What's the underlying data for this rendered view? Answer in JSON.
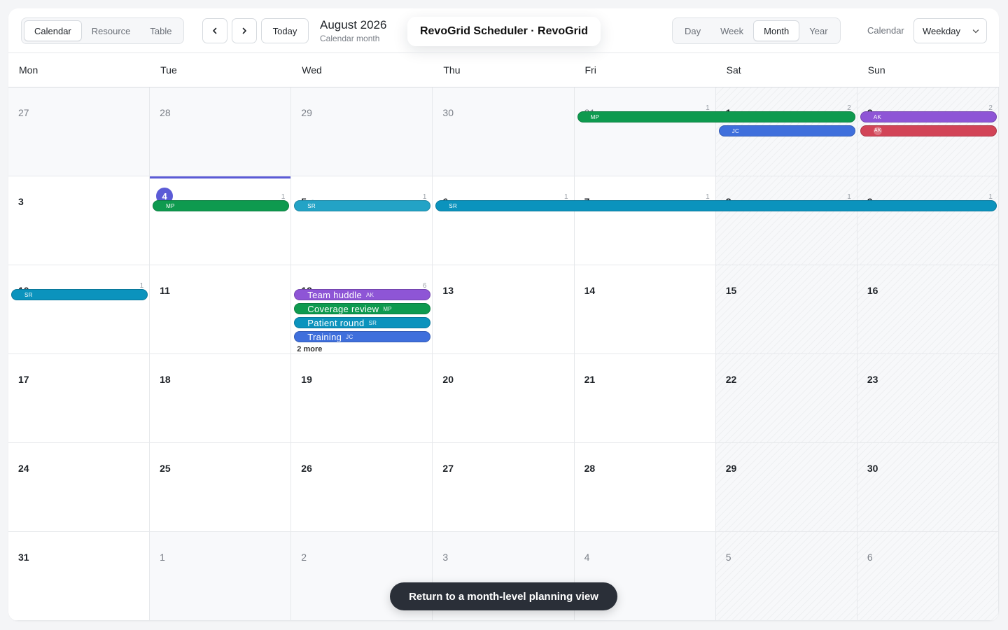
{
  "view_switch": {
    "items": [
      "Calendar",
      "Resource",
      "Table"
    ],
    "active": "Calendar"
  },
  "nav": {
    "prev_icon": "chevron-left-icon",
    "next_icon": "chevron-right-icon",
    "today_label": "Today"
  },
  "period": {
    "title": "August 2026",
    "subtitle": "Calendar month"
  },
  "app_title": "RevoGrid Scheduler · RevoGrid",
  "range_switch": {
    "items": [
      "Day",
      "Week",
      "Month",
      "Year"
    ],
    "active": "Month"
  },
  "calendar_select": {
    "label": "Calendar",
    "value": "Weekday",
    "icon": "chevron-down-icon"
  },
  "weekdays": [
    "Mon",
    "Tue",
    "Wed",
    "Thu",
    "Fri",
    "Sat",
    "Sun"
  ],
  "days": [
    {
      "d": "27",
      "out": true
    },
    {
      "d": "28",
      "out": true
    },
    {
      "d": "29",
      "out": true
    },
    {
      "d": "30",
      "out": true
    },
    {
      "d": "31",
      "out": true,
      "count": "1"
    },
    {
      "d": "1",
      "count": "2"
    },
    {
      "d": "2",
      "count": "2"
    },
    {
      "d": "3"
    },
    {
      "d": "4",
      "today": true,
      "count": "1"
    },
    {
      "d": "5",
      "count": "1",
      "locked": true
    },
    {
      "d": "6",
      "count": "1"
    },
    {
      "d": "7",
      "count": "1"
    },
    {
      "d": "8",
      "count": "1"
    },
    {
      "d": "9",
      "count": "1"
    },
    {
      "d": "10",
      "count": "1"
    },
    {
      "d": "11"
    },
    {
      "d": "12",
      "count": "6",
      "more": "2 more"
    },
    {
      "d": "13"
    },
    {
      "d": "14"
    },
    {
      "d": "15"
    },
    {
      "d": "16"
    },
    {
      "d": "17"
    },
    {
      "d": "18"
    },
    {
      "d": "19"
    },
    {
      "d": "20"
    },
    {
      "d": "21"
    },
    {
      "d": "22"
    },
    {
      "d": "23"
    },
    {
      "d": "24"
    },
    {
      "d": "25"
    },
    {
      "d": "26"
    },
    {
      "d": "27"
    },
    {
      "d": "28"
    },
    {
      "d": "29"
    },
    {
      "d": "30"
    },
    {
      "d": "31"
    },
    {
      "d": "1",
      "out": true
    },
    {
      "d": "2",
      "out": true
    },
    {
      "d": "3",
      "out": true
    },
    {
      "d": "4",
      "out": true
    },
    {
      "d": "5",
      "out": true
    },
    {
      "d": "6",
      "out": true
    }
  ],
  "events": [
    {
      "title": "",
      "initials": "MP",
      "color": "#0e9a4f",
      "row": 0,
      "col": 4,
      "span": 2,
      "lane": 0
    },
    {
      "title": "",
      "initials": "JC",
      "color": "#3f6fdc",
      "row": 0,
      "col": 5,
      "span": 1,
      "lane": 1
    },
    {
      "title": "",
      "initials": "AK",
      "color": "#8e55d6",
      "row": 0,
      "col": 6,
      "span": 1,
      "lane": 0
    },
    {
      "title": "",
      "initials": "AK",
      "color": "#d24457",
      "row": 0,
      "col": 6,
      "span": 1,
      "lane": 1,
      "avatar": true
    },
    {
      "title": "",
      "initials": "MP",
      "color": "#0e9a4f",
      "row": 1,
      "col": 1,
      "span": 1,
      "lane": 0
    },
    {
      "title": "",
      "initials": "SR",
      "color": "#23a3c6",
      "row": 1,
      "col": 2,
      "span": 1,
      "lane": 0
    },
    {
      "title": "",
      "initials": "SR",
      "color": "#0b93bd",
      "row": 1,
      "col": 3,
      "span": 4,
      "lane": 0
    },
    {
      "title": "",
      "initials": "SR",
      "color": "#0b93bd",
      "row": 2,
      "col": 0,
      "span": 1,
      "lane": 0
    },
    {
      "title": "Team huddle",
      "initials": "AK",
      "color": "#8e55d6",
      "row": 2,
      "col": 2,
      "span": 1,
      "lane": 0
    },
    {
      "title": "Coverage review",
      "initials": "MP",
      "color": "#0e9a4f",
      "row": 2,
      "col": 2,
      "span": 1,
      "lane": 1
    },
    {
      "title": "Patient round",
      "initials": "SR",
      "color": "#0b93bd",
      "row": 2,
      "col": 2,
      "span": 1,
      "lane": 2
    },
    {
      "title": "Training",
      "initials": "JC",
      "color": "#3f6fdc",
      "row": 2,
      "col": 2,
      "span": 1,
      "lane": 3
    }
  ],
  "tooltip": "Return to a month-level planning view"
}
